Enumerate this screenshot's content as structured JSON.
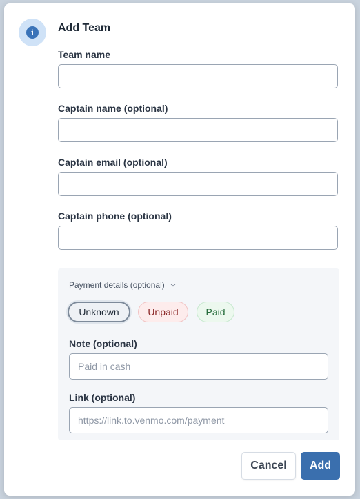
{
  "dialog": {
    "title": "Add Team",
    "icon": "info-icon"
  },
  "fields": {
    "team_name": {
      "label": "Team name",
      "value": ""
    },
    "captain_name": {
      "label": "Captain name (optional)",
      "value": ""
    },
    "captain_email": {
      "label": "Captain email (optional)",
      "value": ""
    },
    "captain_phone": {
      "label": "Captain phone (optional)",
      "value": ""
    }
  },
  "payment": {
    "header": "Payment details (optional)",
    "statuses": [
      {
        "label": "Unknown",
        "selected": true
      },
      {
        "label": "Unpaid",
        "selected": false
      },
      {
        "label": "Paid",
        "selected": false
      }
    ],
    "note": {
      "label": "Note (optional)",
      "placeholder": "Paid in cash",
      "value": ""
    },
    "link": {
      "label": "Link (optional)",
      "placeholder": "https://link.to.venmo.com/payment",
      "value": ""
    }
  },
  "actions": {
    "cancel_label": "Cancel",
    "add_label": "Add"
  },
  "colors": {
    "primary": "#3a6fae",
    "info_bg": "#cfe2f7",
    "unpaid_bg": "#fdecec",
    "paid_bg": "#ecf8ee"
  }
}
